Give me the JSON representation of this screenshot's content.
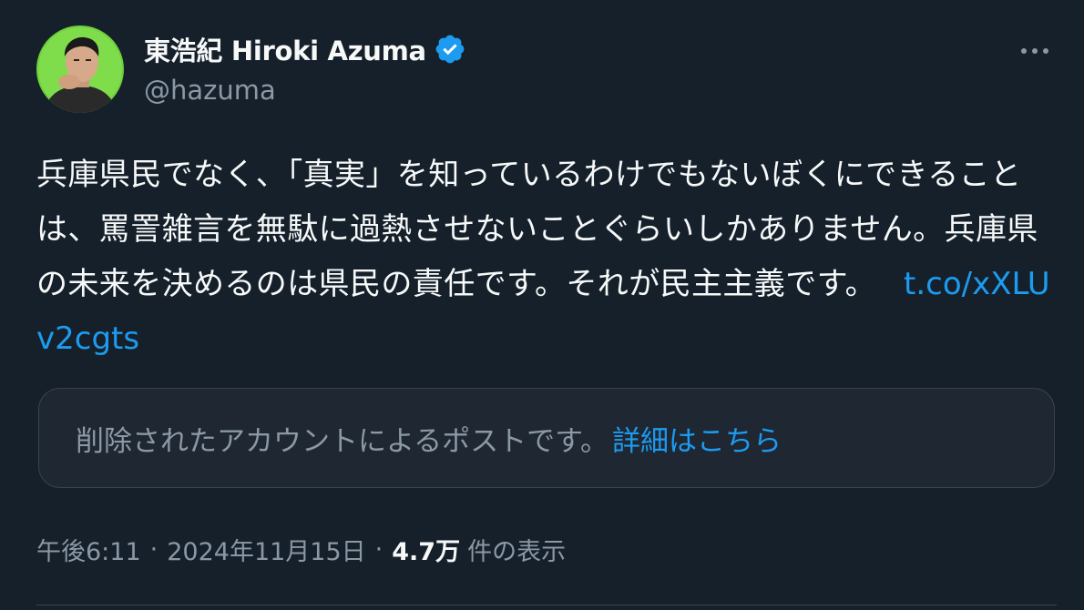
{
  "author": {
    "display_name": "東浩紀 Hiroki Azuma",
    "handle": "@hazuma",
    "verified": true,
    "avatar_icon": "profile-photo-avatar"
  },
  "tweet": {
    "text": "兵庫県民でなく、「真実」を知っているわけでもないぼくにできることは、罵詈雑言を無駄に過熱させないことぐらいしかありません。兵庫県の未来を決めるのは県民の責任です。それが民主主義です。",
    "link": "t.co/xXLUv2cgts"
  },
  "quoted_notice": {
    "message": "削除されたアカウントによるポストです。",
    "link_label": "詳細はこちら"
  },
  "meta": {
    "time": "午後6:11",
    "date": "2024年11月15日",
    "views_count": "4.7万",
    "views_label": "件の表示",
    "separator": "·"
  },
  "colors": {
    "background": "#15202b",
    "text": "#f7f9f9",
    "secondary": "#8b98a5",
    "accent": "#1d9bf0",
    "border": "#38444d"
  },
  "icons": {
    "verified": "verified-badge-icon",
    "more": "more-horizontal-icon"
  }
}
